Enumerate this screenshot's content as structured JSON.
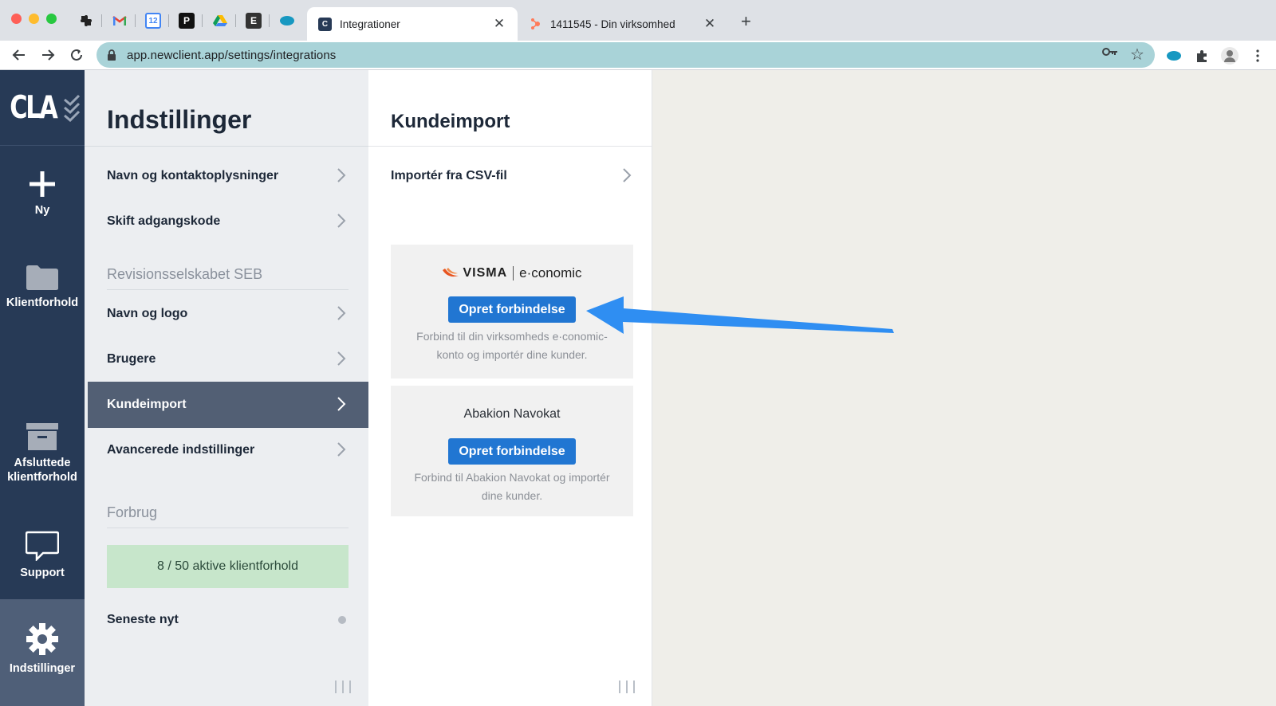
{
  "browser": {
    "pinned_tabs": [
      "slack-icon",
      "gmail-icon",
      "calendar-icon",
      "p-icon",
      "drive-icon",
      "e-icon",
      "salesforce-icon"
    ],
    "tabs": [
      {
        "title": "Integrationer",
        "active": true
      },
      {
        "title": "1411545 - Din virksomhed",
        "active": false
      }
    ],
    "url": "app.newclient.app/settings/integrations"
  },
  "appnav": {
    "logo": "CLA",
    "items": [
      {
        "label": "Ny"
      },
      {
        "label": "Klientforhold"
      },
      {
        "label": "Afsluttede klientforhold"
      },
      {
        "label": "Support"
      },
      {
        "label": "Indstillinger",
        "active": true
      }
    ]
  },
  "settings": {
    "title": "Indstillinger",
    "items": [
      {
        "label": "Navn og kontaktoplysninger"
      },
      {
        "label": "Skift adgangskode"
      },
      {
        "label": "Navn og logo"
      },
      {
        "label": "Brugere"
      },
      {
        "label": "Kundeimport",
        "active": true
      },
      {
        "label": "Avancerede indstillinger"
      }
    ],
    "section_company": "Revisionsselskabet SEB",
    "section_usage": "Forbrug",
    "usage_text": "8 / 50 aktive klientforhold",
    "news_label": "Seneste nyt"
  },
  "kundeimport": {
    "title": "Kundeimport",
    "csv_label": "Importér fra CSV-fil",
    "integrations": [
      {
        "brand_primary": "VISMA",
        "brand_secondary": "e·conomic",
        "button": "Opret forbindelse",
        "description": "Forbind til din virksomheds e·conomic-konto og importér dine kunder."
      },
      {
        "brand_primary": "Abakion Navokat",
        "button": "Opret forbindelse",
        "description": "Forbind til Abakion Navokat og importér dine kunder."
      }
    ]
  },
  "colors": {
    "nav_bg": "#273a56",
    "active_row": "#525f74",
    "primary_button": "#2176d2",
    "usage_bg": "#c7e6cb",
    "annotation_arrow": "#2f8ef2"
  }
}
